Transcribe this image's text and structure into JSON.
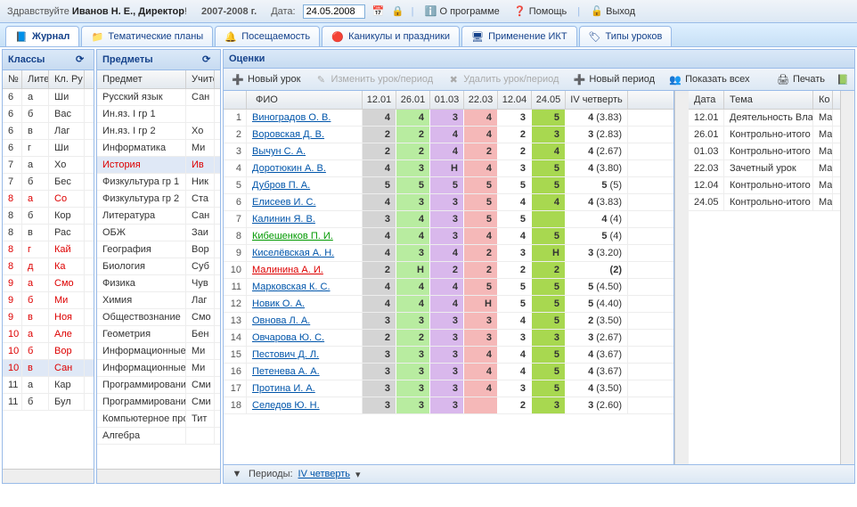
{
  "header": {
    "greeting_prefix": "Здравствуйте ",
    "user": "Иванов Н. Е., Директор",
    "greeting_suffix": "!",
    "year": "2007-2008 г.",
    "date_label": "Дата:",
    "date_value": "24.05.2008",
    "about": "О программе",
    "help": "Помощь",
    "exit": "Выход"
  },
  "tabs": [
    {
      "label": "Журнал",
      "icon": "book-icon",
      "active": true
    },
    {
      "label": "Тематические планы",
      "icon": "folder-icon"
    },
    {
      "label": "Посещаемость",
      "icon": "bell-icon"
    },
    {
      "label": "Каникулы и праздники",
      "icon": "sun-icon"
    },
    {
      "label": "Применение ИКТ",
      "icon": "monitor-icon"
    },
    {
      "label": "Типы уроков",
      "icon": "tag-icon"
    }
  ],
  "classes": {
    "title": "Классы",
    "cols": [
      "№",
      "Лите",
      "Кл. Ру"
    ],
    "rows": [
      {
        "n": "6",
        "l": "а",
        "r": "Ши"
      },
      {
        "n": "6",
        "l": "б",
        "r": "Вас"
      },
      {
        "n": "6",
        "l": "в",
        "r": "Лаг"
      },
      {
        "n": "6",
        "l": "г",
        "r": "Ши"
      },
      {
        "n": "7",
        "l": "а",
        "r": "Хо"
      },
      {
        "n": "7",
        "l": "б",
        "r": "Бес"
      },
      {
        "n": "8",
        "l": "а",
        "r": "Со",
        "red": true
      },
      {
        "n": "8",
        "l": "б",
        "r": "Кор"
      },
      {
        "n": "8",
        "l": "в",
        "r": "Рас"
      },
      {
        "n": "8",
        "l": "г",
        "r": "Кай",
        "red": true
      },
      {
        "n": "8",
        "l": "д",
        "r": "Ка",
        "red": true
      },
      {
        "n": "9",
        "l": "а",
        "r": "Смо",
        "red": true
      },
      {
        "n": "9",
        "l": "б",
        "r": "Ми",
        "red": true
      },
      {
        "n": "9",
        "l": "в",
        "r": "Ноя",
        "red": true
      },
      {
        "n": "10",
        "l": "а",
        "r": "Але",
        "red": true
      },
      {
        "n": "10",
        "l": "б",
        "r": "Вор",
        "red": true
      },
      {
        "n": "10",
        "l": "в",
        "r": "Сан",
        "red": true,
        "selected": true
      },
      {
        "n": "11",
        "l": "а",
        "r": "Кар"
      },
      {
        "n": "11",
        "l": "б",
        "r": "Бул"
      }
    ]
  },
  "subjects": {
    "title": "Предметы",
    "cols": [
      "Предмет",
      "Учите"
    ],
    "rows": [
      {
        "s": "Русский язык",
        "t": "Сан"
      },
      {
        "s": "Ин.яз. I гр 1",
        "t": ""
      },
      {
        "s": "Ин.яз. I гр 2",
        "t": "Хо"
      },
      {
        "s": "Информатика",
        "t": "Ми"
      },
      {
        "s": "История",
        "t": "Ив",
        "selected": true,
        "red": true
      },
      {
        "s": "Физкультура гр 1",
        "t": "Ник"
      },
      {
        "s": "Физкультура гр 2",
        "t": "Ста"
      },
      {
        "s": "Литература",
        "t": "Сан"
      },
      {
        "s": "ОБЖ",
        "t": "Заи"
      },
      {
        "s": "География",
        "t": "Вор"
      },
      {
        "s": "Биология",
        "t": "Суб"
      },
      {
        "s": "Физика",
        "t": "Чув"
      },
      {
        "s": "Химия",
        "t": "Лаг"
      },
      {
        "s": "Обществознание",
        "t": "Смо"
      },
      {
        "s": "Геометрия",
        "t": "Бен"
      },
      {
        "s": "Информационные т",
        "t": "Ми"
      },
      {
        "s": "Информационные т",
        "t": "Ми"
      },
      {
        "s": "Программирование",
        "t": "Сми"
      },
      {
        "s": "Программирование",
        "t": "Сми"
      },
      {
        "s": "Компьютерное про",
        "t": "Тит"
      },
      {
        "s": "Алгебра",
        "t": ""
      }
    ]
  },
  "grades": {
    "title": "Оценки",
    "toolbar": {
      "new_lesson": "Новый урок",
      "edit": "Изменить урок/период",
      "delete": "Удалить урок/период",
      "new_period": "Новый период",
      "show_all": "Показать всех",
      "print": "Печать"
    },
    "cols": {
      "fio": "ФИО",
      "dates": [
        "12.01",
        "26.01",
        "01.03",
        "22.03",
        "12.04",
        "24.05"
      ],
      "quarter": "IV четверть"
    },
    "rows": [
      {
        "n": 1,
        "name": "Виноградов О. В.",
        "g": [
          "4",
          "4",
          "3",
          "4",
          "3",
          "5"
        ],
        "q": "4 (3.83)"
      },
      {
        "n": 2,
        "name": "Воровская Д. В.",
        "g": [
          "2",
          "2",
          "4",
          "4",
          "2",
          "3"
        ],
        "q": "3 (2.83)"
      },
      {
        "n": 3,
        "name": "Вычун С. А.",
        "g": [
          "2",
          "2",
          "4",
          "2",
          "2",
          "4"
        ],
        "q": "4 (2.67)"
      },
      {
        "n": 4,
        "name": "Доротюкин А. В.",
        "g": [
          "4",
          "3",
          "Н",
          "4",
          "3",
          "5"
        ],
        "q": "4 (3.80)"
      },
      {
        "n": 5,
        "name": "Дубров П. А.",
        "g": [
          "5",
          "5",
          "5",
          "5",
          "5",
          "5"
        ],
        "q": "5 (5)"
      },
      {
        "n": 6,
        "name": "Елисеев И. С.",
        "g": [
          "4",
          "3",
          "3",
          "5",
          "4",
          "4"
        ],
        "q": "4 (3.83)"
      },
      {
        "n": 7,
        "name": "Калинин Я. В.",
        "g": [
          "3",
          "4",
          "3",
          "5",
          "5",
          ""
        ],
        "q": "4 (4)"
      },
      {
        "n": 8,
        "name": "Кибешенков П. И.",
        "g": [
          "4",
          "4",
          "3",
          "4",
          "4",
          "5"
        ],
        "q": "5 (4)",
        "green": true
      },
      {
        "n": 9,
        "name": "Киселёвская А. Н.",
        "g": [
          "4",
          "3",
          "4",
          "2",
          "3",
          "Н"
        ],
        "q": "3 (3.20)"
      },
      {
        "n": 10,
        "name": "Малинина А. И.",
        "g": [
          "2",
          "Н",
          "2",
          "2",
          "2",
          "2"
        ],
        "q": "(2)",
        "red": true
      },
      {
        "n": 11,
        "name": "Марковская К. С.",
        "g": [
          "4",
          "4",
          "4",
          "5",
          "5",
          "5"
        ],
        "q": "5 (4.50)"
      },
      {
        "n": 12,
        "name": "Новик О. А.",
        "g": [
          "4",
          "4",
          "4",
          "Н",
          "5",
          "5"
        ],
        "q": "5 (4.40)"
      },
      {
        "n": 13,
        "name": "Овнова Л. А.",
        "g": [
          "3",
          "3",
          "3",
          "3",
          "4",
          "5"
        ],
        "q": "2 (3.50)"
      },
      {
        "n": 14,
        "name": "Овчарова Ю. С.",
        "g": [
          "2",
          "2",
          "3",
          "3",
          "3",
          "3"
        ],
        "q": "3 (2.67)"
      },
      {
        "n": 15,
        "name": "Пестович Д. Л.",
        "g": [
          "3",
          "3",
          "3",
          "4",
          "4",
          "5"
        ],
        "q": "4 (3.67)"
      },
      {
        "n": 16,
        "name": "Петенева А. А.",
        "g": [
          "3",
          "3",
          "3",
          "4",
          "4",
          "5"
        ],
        "q": "4 (3.67)"
      },
      {
        "n": 17,
        "name": "Протина И. А.",
        "g": [
          "3",
          "3",
          "3",
          "4",
          "3",
          "5"
        ],
        "q": "4 (3.50)"
      },
      {
        "n": 18,
        "name": "Селедов Ю. Н.",
        "g": [
          "3",
          "3",
          "3",
          "",
          "2",
          "3"
        ],
        "q": "3 (2.60)"
      }
    ],
    "side": {
      "cols": [
        "Дата",
        "Тема",
        "Ко"
      ],
      "rows": [
        {
          "d": "12.01",
          "t": "Деятельность Вла",
          "k": "Ма"
        },
        {
          "d": "26.01",
          "t": "Контрольно-итого",
          "k": "Ма"
        },
        {
          "d": "01.03",
          "t": "Контрольно-итого",
          "k": "Ма"
        },
        {
          "d": "22.03",
          "t": "Зачетный урок",
          "k": "Ма"
        },
        {
          "d": "12.04",
          "t": "Контрольно-итого",
          "k": "Ма"
        },
        {
          "d": "24.05",
          "t": "Контрольно-итого",
          "k": "Ма"
        }
      ]
    },
    "footer": {
      "periods_label": "Периоды:",
      "period_value": "IV четверть"
    }
  }
}
